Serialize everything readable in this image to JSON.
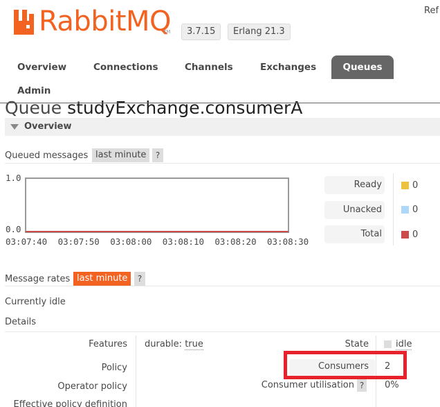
{
  "header": {
    "logo_text": "RabbitMQ",
    "logo_tm": "TM",
    "version": "3.7.15",
    "erlang": "Erlang 21.3",
    "ref": "Ref"
  },
  "nav": {
    "tabs": [
      {
        "label": "Overview"
      },
      {
        "label": "Connections"
      },
      {
        "label": "Channels"
      },
      {
        "label": "Exchanges"
      },
      {
        "label": "Queues",
        "active": true
      },
      {
        "label": "Admin"
      }
    ]
  },
  "page": {
    "title_prefix": "Queue",
    "title_name": "studyExchange.consumerA"
  },
  "overview": {
    "section_label": "Overview",
    "queued_messages_label": "Queued messages",
    "range_label": "last minute",
    "help": "?"
  },
  "chart_data": {
    "type": "line",
    "x": [
      "03:07:40",
      "03:07:50",
      "03:08:00",
      "03:08:10",
      "03:08:20",
      "03:08:30"
    ],
    "ylim": [
      0.0,
      1.0
    ],
    "y_ticks": [
      "1.0",
      "0.0"
    ],
    "series": [
      {
        "name": "Ready",
        "color": "#edc240",
        "values": [
          0,
          0,
          0,
          0,
          0,
          0
        ]
      },
      {
        "name": "Unacked",
        "color": "#afd8f8",
        "values": [
          0,
          0,
          0,
          0,
          0,
          0
        ]
      },
      {
        "name": "Total",
        "color": "#cb4b4b",
        "values": [
          0,
          0,
          0,
          0,
          0,
          0
        ]
      }
    ],
    "legend": [
      {
        "label": "Ready",
        "value": "0",
        "color": "#edc240"
      },
      {
        "label": "Unacked",
        "value": "0",
        "color": "#afd8f8"
      },
      {
        "label": "Total",
        "value": "0",
        "color": "#cb4b4b"
      }
    ]
  },
  "message_rates": {
    "label": "Message rates",
    "range_label": "last minute",
    "help": "?",
    "status": "Currently idle"
  },
  "details": {
    "label": "Details",
    "features_label": "Features",
    "features_key": "durable:",
    "features_value": "true",
    "policy_label": "Policy",
    "operator_policy_label": "Operator policy",
    "effective_policy_label": "Effective policy definition",
    "state_label": "State",
    "state_value": "idle",
    "consumers_label": "Consumers",
    "consumers_value": "2",
    "consumer_util_label": "Consumer utilisation",
    "consumer_util_help": "?",
    "consumer_util_value": "0%"
  },
  "colors": {
    "brand": "#f26322",
    "nav_active": "#666666",
    "highlight": "#e8222c"
  }
}
